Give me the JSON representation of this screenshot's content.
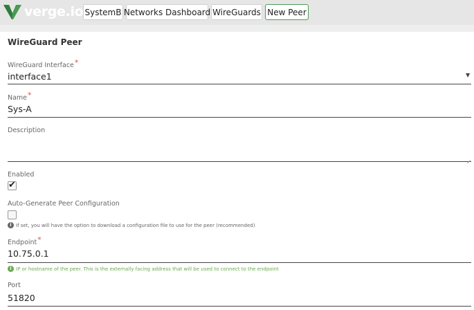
{
  "header": {
    "logo_text": "verge.io",
    "breadcrumbs": [
      "SystemB",
      "Networks Dashboard",
      "WireGuards",
      "New Peer"
    ]
  },
  "form": {
    "section_title": "WireGuard Peer",
    "interface": {
      "label": "WireGuard Interface",
      "required_mark": "*",
      "value": "interface1",
      "arrow": "▼"
    },
    "name": {
      "label": "Name",
      "required_mark": "*",
      "value": "Sys-A"
    },
    "description": {
      "label": "Description",
      "value": ""
    },
    "enabled": {
      "label": "Enabled",
      "checked": true,
      "check_glyph": "✔"
    },
    "auto_generate": {
      "label": "Auto-Generate Peer Configuration",
      "checked": false,
      "hint": "If set, you will have the option to download a configuration file to use for the peer (recommended)"
    },
    "endpoint": {
      "label": "Endpoint",
      "required_mark": "*",
      "value": "10.75.0.1",
      "hint": "IP or hostname of the peer. This is the externally facing address that will be used to connect to the endpoint"
    },
    "port": {
      "label": "Port",
      "value": "51820"
    },
    "info_glyph": "i"
  },
  "colors": {
    "topbar": "#e6e6e6",
    "logo_green": "#4a9a53",
    "required": "#d9534f",
    "hint_green": "#6aa84f"
  }
}
